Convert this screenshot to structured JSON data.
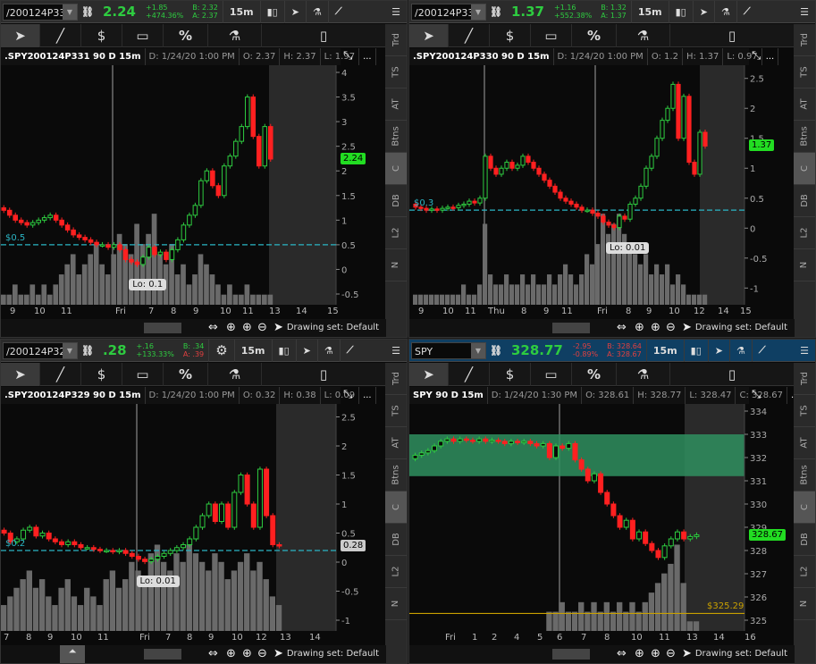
{
  "common": {
    "drawing_set": "Drawing set: Default",
    "interval": "15m",
    "side_tabs": [
      "Trd",
      "TS",
      "AT",
      "Btns",
      "C",
      "DB",
      "L2",
      "N"
    ],
    "draw_tools": [
      "pointer-tool",
      "line-tool",
      "price-level-tool",
      "rectangle-tool",
      "percent-tool",
      "studies-tool",
      "style-tool"
    ],
    "percent": "%",
    "dollar": "$",
    "more": "...",
    "colors": {
      "up": "#2ecc40",
      "down": "#ff2020",
      "volume": "#6a6a6a",
      "cyan": "#2bb5c4",
      "gold": "#c8a000",
      "zone": "#2f8f5f"
    }
  },
  "panels": [
    {
      "symbol": "/200124P331",
      "last": "2.24",
      "change": "+1.85",
      "change_pct": "+474.36%",
      "bid": "B: 2.32",
      "ask": "A: 2.37",
      "bidask_color": "green",
      "title": ".SPY200124P331 90 D 15m",
      "date": "D: 1/24/20 1:00 PM",
      "open": "O: 2.37",
      "high": "H: 2.37",
      "low": "L: 1.97",
      "close": null,
      "price_ticks": [
        "4",
        "3.5",
        "3",
        "2.5",
        "2",
        "1.5",
        "1",
        "0.5",
        "0",
        "-0.5"
      ],
      "ymax": 4,
      "ymin": -0.5,
      "level_label": "$0.5",
      "level": 0.5,
      "lo_label": "Lo: 0.1",
      "price_label": "2.24",
      "x_labels": [
        "9",
        "10",
        "11",
        "Fri",
        "7",
        "8",
        "9",
        "10",
        "11",
        "13",
        "14",
        "15"
      ],
      "closes": [
        1.2,
        1.1,
        1.0,
        0.95,
        0.9,
        0.95,
        1.0,
        1.05,
        1.1,
        1.0,
        0.9,
        0.8,
        0.7,
        0.65,
        0.6,
        0.55,
        0.5,
        0.5,
        0.45,
        0.5,
        0.4,
        0.2,
        0.15,
        0.1,
        0.25,
        0.45,
        0.3,
        0.35,
        0.2,
        0.4,
        0.6,
        0.9,
        1.1,
        1.3,
        1.8,
        2.0,
        1.7,
        1.5,
        2.1,
        2.3,
        2.6,
        2.9,
        3.5,
        2.7,
        2.1,
        2.9,
        2.24
      ],
      "volume": [
        1,
        1,
        2,
        1,
        1,
        2,
        1,
        2,
        1,
        2,
        3,
        4,
        5,
        3,
        4,
        5,
        6,
        4,
        3,
        5,
        7,
        6,
        5,
        8,
        6,
        7,
        9,
        5,
        4,
        6,
        3,
        4,
        2,
        3,
        5,
        4,
        3,
        2,
        1,
        2,
        1,
        1,
        2,
        1,
        1,
        1,
        1
      ]
    },
    {
      "symbol": "/200124P330",
      "last": "1.37",
      "change": "+1.16",
      "change_pct": "+552.38%",
      "bid": "B: 1.32",
      "ask": "A: 1.37",
      "bidask_color": "green",
      "title": ".SPY200124P330 90 D 15m",
      "date": "D: 1/24/20 1:00 PM",
      "open": "O: 1.2",
      "high": "H: 1.37",
      "low": "L: 0.97",
      "close": null,
      "price_ticks": [
        "2.5",
        "2",
        "1.5",
        "1",
        "0.5",
        "0",
        "-0.5",
        "-1"
      ],
      "ymax": 2.6,
      "ymin": -1.1,
      "level_label": "$0.3",
      "level": 0.3,
      "lo_label": "Lo: 0.01",
      "price_label": "1.37",
      "x_labels": [
        "9",
        "10",
        "11",
        "Thu",
        "8",
        "9",
        "11",
        "Fri",
        "8",
        "9",
        "10",
        "12",
        "14",
        "15"
      ],
      "closes": [
        0.35,
        0.33,
        0.3,
        0.32,
        0.3,
        0.33,
        0.35,
        0.34,
        0.38,
        0.4,
        0.45,
        0.42,
        0.5,
        1.2,
        1.0,
        0.9,
        1.0,
        1.1,
        1.0,
        1.05,
        1.2,
        1.1,
        1.0,
        0.9,
        0.8,
        0.7,
        0.6,
        0.5,
        0.45,
        0.4,
        0.35,
        0.3,
        0.3,
        0.25,
        0.2,
        0.1,
        0.05,
        0.01,
        0.2,
        0.15,
        0.4,
        0.5,
        0.7,
        1.0,
        1.2,
        1.5,
        1.8,
        2.0,
        2.4,
        1.5,
        2.2,
        1.1,
        0.9,
        1.6,
        1.37
      ],
      "volume": [
        1,
        1,
        1,
        1,
        1,
        1,
        1,
        1,
        1,
        2,
        1,
        1,
        2,
        8,
        3,
        2,
        2,
        3,
        2,
        2,
        3,
        2,
        3,
        2,
        2,
        3,
        2,
        3,
        4,
        3,
        2,
        3,
        5,
        4,
        6,
        9,
        7,
        8,
        9,
        7,
        6,
        5,
        4,
        5,
        3,
        4,
        3,
        4,
        2,
        3,
        2,
        1,
        1,
        1,
        1
      ]
    },
    {
      "symbol": "/200124P329",
      "last": ".28",
      "change": "+.16",
      "change_pct": "+133.33%",
      "bid": "B: .34",
      "ask": "A: .39",
      "bidask_color": "mixed",
      "title": ".SPY200124P329 90 D 15m",
      "date": "D: 1/24/20 1:00 PM",
      "open": "O: 0.32",
      "high": "H: 0.38",
      "low": "L: 0.09",
      "close": null,
      "price_ticks": [
        "2.5",
        "2",
        "1.5",
        "1",
        "0.5",
        "0",
        "-0.5",
        "-1"
      ],
      "ymax": 2.6,
      "ymin": -1.0,
      "level_label": "$0.2",
      "level": 0.2,
      "lo_label": "Lo: 0.01",
      "price_label": "0.28",
      "x_labels": [
        "7",
        "8",
        "9",
        "10",
        "11",
        "Fri",
        "7",
        "8",
        "9",
        "10",
        "12",
        "13",
        "14"
      ],
      "closes": [
        0.5,
        0.35,
        0.4,
        0.55,
        0.6,
        0.45,
        0.5,
        0.4,
        0.35,
        0.3,
        0.35,
        0.3,
        0.25,
        0.25,
        0.22,
        0.2,
        0.2,
        0.18,
        0.2,
        0.15,
        0.1,
        0.05,
        0.01,
        0.05,
        0.1,
        0.15,
        0.2,
        0.25,
        0.3,
        0.4,
        0.6,
        0.8,
        1.0,
        0.7,
        1.0,
        0.6,
        1.2,
        1.5,
        1.0,
        0.6,
        1.6,
        0.8,
        0.3,
        0.28
      ],
      "volume": [
        3,
        4,
        5,
        6,
        7,
        5,
        6,
        4,
        3,
        5,
        6,
        4,
        3,
        5,
        4,
        3,
        6,
        7,
        5,
        6,
        8,
        7,
        6,
        9,
        10,
        8,
        7,
        9,
        8,
        10,
        9,
        8,
        7,
        9,
        8,
        6,
        7,
        8,
        9,
        7,
        8,
        6,
        4,
        3
      ]
    },
    {
      "symbol": "SPY",
      "last": "328.77",
      "change": "-2.95",
      "change_pct": "-0.89%",
      "bid": "B: 328.64",
      "ask": "A: 328.67",
      "bidask_color": "red",
      "title": "SPY 90 D 15m",
      "date": "D: 1/24/20 1:30 PM",
      "open": "O: 328.61",
      "high": "H: 328.77",
      "low": "L: 328.47",
      "close": "C: 328.67",
      "price_ticks": [
        "334",
        "333",
        "332",
        "331",
        "330",
        "329",
        "328",
        "327",
        "326",
        "325"
      ],
      "ymax": 334,
      "ymin": 325,
      "level_label": "$325.29",
      "level": 325.29,
      "lo_label": null,
      "price_label": "328.67",
      "zone": [
        331.2,
        333
      ],
      "x_labels": [
        "Fri",
        "1",
        "2",
        "4",
        "5",
        "6",
        "7",
        "8",
        "10",
        "11",
        "13",
        "14",
        "16"
      ],
      "closes": [
        332.1,
        332.2,
        332.3,
        332.5,
        332.7,
        332.8,
        332.7,
        332.8,
        332.75,
        332.7,
        332.8,
        332.7,
        332.75,
        332.7,
        332.6,
        332.7,
        332.65,
        332.7,
        332.6,
        332.5,
        332.6,
        332.0,
        332.5,
        332.4,
        332.6,
        331.9,
        331.5,
        331.0,
        331.3,
        330.5,
        330.0,
        329.5,
        329.0,
        329.3,
        328.5,
        328.8,
        328.3,
        328.0,
        327.7,
        328.2,
        328.5,
        328.8,
        328.5,
        328.6,
        328.67
      ],
      "volume": [
        0,
        0,
        0,
        0,
        0,
        0,
        0,
        0,
        0,
        0,
        0,
        0,
        0,
        0,
        0,
        0,
        0,
        0,
        0,
        0,
        0,
        2,
        2,
        3,
        2,
        2,
        3,
        2,
        3,
        2,
        3,
        2,
        3,
        2,
        3,
        2,
        3,
        4,
        5,
        6,
        7,
        9,
        5,
        1,
        1
      ]
    }
  ]
}
